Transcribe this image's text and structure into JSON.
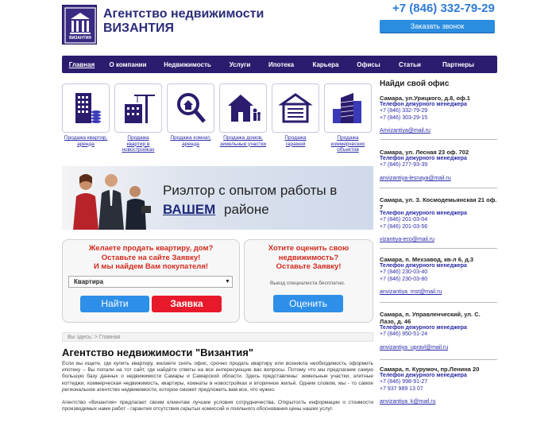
{
  "header": {
    "brand_line1": "Агентство недвижимости",
    "brand_line2": "ВИЗАНТИЯ",
    "logo_text": "ВИЗАНТИЯ",
    "phone": "+7 (846) 332-79-29",
    "callback_label": "Заказать звонок"
  },
  "nav": {
    "items": [
      "Главная",
      "О компании",
      "Недвижимость",
      "Услуги",
      "Ипотека",
      "Карьера",
      "Офисы",
      "Статьи",
      "Партнеры"
    ]
  },
  "categories": [
    {
      "label1": "Продажа квартир,",
      "label2": "аренда",
      "icon": "apartment-building-icon"
    },
    {
      "label1": "Продажа",
      "label2": "квартир в новостройках",
      "icon": "construction-crane-icon"
    },
    {
      "label1": "Продажа комнат,",
      "label2": "аренда",
      "icon": "magnifier-house-icon"
    },
    {
      "label1": "Продажа домов,",
      "label2": "земельные участки",
      "icon": "house-family-icon"
    },
    {
      "label1": "Продажа",
      "label2": "гаражей",
      "icon": "garage-icon"
    },
    {
      "label1": "Продажа",
      "label2": "коммерческих объектов",
      "icon": "office-tower-icon"
    }
  ],
  "banner": {
    "line1": "Риэлтор с опытом работы в",
    "line2_highlight": "ВАШЕМ",
    "line2_rest": "районе"
  },
  "sell_form": {
    "line1": "Желаете продать квартиру, дом?",
    "line2": "Оставьте на сайте Заявку!",
    "line3": "И мы найдем  Вам покупателя!",
    "select_value": "Квартира",
    "find_label": "Найти",
    "order_label": "Заявка"
  },
  "eval_form": {
    "line1": "Хотите оценить свою",
    "line2": "недвижимость?",
    "line3": "Оставьте Заявку!",
    "hint": "Выезд специалиста бесплатно.",
    "button_label": "Оценить"
  },
  "breadcrumb": "Вы здесь:  > Главная",
  "page_title": "Агентство недвижимости \"Византия\"",
  "paragraph1": "Если вы ищете, где купить квартиру, желаете снять офис, срочно продать квартиру или возникла необходимость оформить ипотеку – Вы попали на тот сайт, где найдёте ответы на все интересующие вас вопросы. Потому что мы предлагаем самую большую базу данных о недвижимости Самары и Самарской области. Здесь представлены: земельные участки, элитные коттеджи, коммерческая недвижимость, квартиры, комнаты в новостройках и вторичное жильё. Одним словом, мы - то самое региональное агентство недвижимости, которое сможет предложить вам все, что нужно.",
  "paragraph2": "Агентство «Византия» предлагает своим клиентам лучшие условия сотрудничества. Открытость информации о стоимости производимых нами работ - гарантия отсутствия скрытых комиссий и лояльного обоснования цены наших услуг.",
  "sidebar": {
    "title": "Найди свой офис",
    "offices": [
      {
        "address": "Самара, ул.Урицкого, д.8, оф.1",
        "label": "Телефон дежурного менеджера",
        "phones": [
          "+7 (846) 332-79-29",
          "+7 (846) 303-29-15"
        ],
        "email": "Anvizantiya@mail.ru"
      },
      {
        "address": "Самара, ул. Лесная 23  оф. 702",
        "label": "Телефон дежурного менеджера",
        "phones": [
          "+7 (846) 277-93-39"
        ],
        "email": "anvizantiya-lesnaya@mail.ru"
      },
      {
        "address": "Самара, ул. З. Космодемьянская 21 оф. 7",
        "label": "Телефон дежурного менеджера",
        "phones": [
          "+7 (846) 201-03-04",
          "+7 (846) 201-03-56"
        ],
        "email": "vizantiya-eco@mail.ru"
      },
      {
        "address": "Самара, п. Мехзавод, кв-л 6, д.3",
        "label": "Телефон дежурного менеджера",
        "phones": [
          "+7 (846) 230-03-40",
          "+7 (846) 230-03-80"
        ],
        "email": "anvizantiya_mst@mail.ru"
      },
      {
        "address": "Самара,  п. Управленческий,  ул. С. Лазо, д. 46",
        "label": "Телефон дежурного менеджера",
        "phones": [
          "+7 (846) 950-51-24"
        ],
        "email": "anvizantiya_upravl@mail.ru"
      },
      {
        "address": "Самара, п. Курумоч, пр.Ленина 20",
        "label": "Телефон дежурного менеджера",
        "phones": [
          "+7 (846) 998-91-27",
          "+7  937 989 13 07"
        ],
        "email": "anvizantiya_k@mail.ru"
      }
    ]
  },
  "colors": {
    "brand": "#2b1c6e",
    "accent_blue": "#2d8fe8",
    "accent_red": "#e8192a",
    "link": "#2a2aa8"
  }
}
